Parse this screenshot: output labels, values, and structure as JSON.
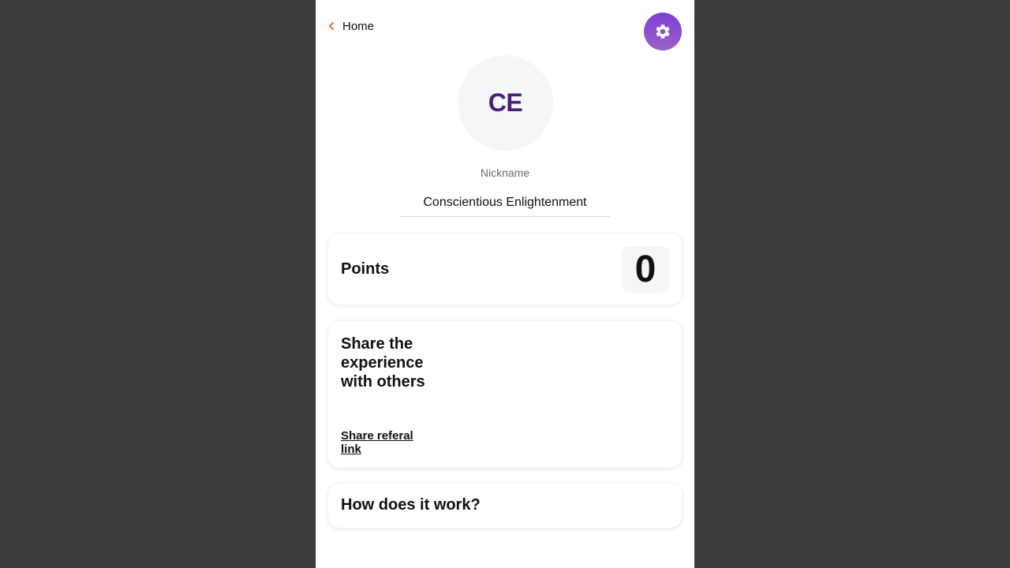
{
  "header": {
    "back_label": "Home",
    "back_icon": "chevron-left-icon",
    "settings_icon": "gear-icon"
  },
  "profile": {
    "initials": "CE",
    "nickname_label": "Nickname",
    "nickname_value": "Conscientious Enlightenment"
  },
  "points_card": {
    "title": "Points",
    "value": "0"
  },
  "share_card": {
    "title": "Share the experience with others",
    "link_label": "Share referal link"
  },
  "how_card": {
    "title": "How does it work?"
  },
  "colors": {
    "accent_chevron": "#e0704a",
    "settings_gradient_top": "#7c3fd6",
    "settings_gradient_bottom": "#9a62c8",
    "initials": "#4b1f7a",
    "backdrop": "#3c3c3c"
  }
}
